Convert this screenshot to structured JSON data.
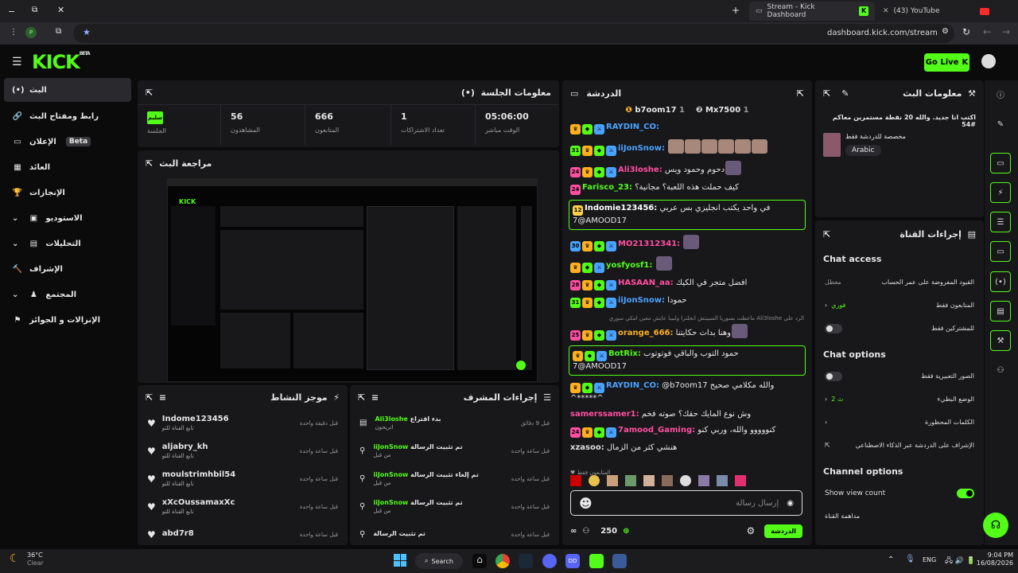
{
  "browser": {
    "tab1": "Stream - Kick Dashboard",
    "tab2": "(43) YouTube",
    "url": "dashboard.kick.com/stream",
    "profile": "P"
  },
  "header": {
    "logo": "KICK",
    "logo_sup": "BETA",
    "go_live": "Go Live"
  },
  "nav": [
    {
      "label": "البث",
      "icon": "(•)"
    },
    {
      "label": "رابط ومفتاح البث",
      "icon": "🔗"
    },
    {
      "label": "الإعلان",
      "icon": "▭",
      "beta": "Beta"
    },
    {
      "label": "العائد",
      "icon": "▦"
    },
    {
      "label": "الإنجازات",
      "icon": "🏆"
    },
    {
      "label": "الاستوديو",
      "icon": "▣"
    },
    {
      "label": "التحليلات",
      "icon": "▤"
    },
    {
      "label": "الإشراف",
      "icon": "🔨"
    },
    {
      "label": "المجتمع",
      "icon": "♟"
    },
    {
      "label": "الإنزالات و الجوائز",
      "icon": "⚑"
    }
  ],
  "session": {
    "title": "معلومات الجلسة",
    "badge": "سليم",
    "badge_label": "الجلسة",
    "stats": [
      {
        "value": "56",
        "label": "المشاهدون"
      },
      {
        "value": "666",
        "label": "المتابعون"
      },
      {
        "value": "1",
        "label": "تعداد الاشتراكات"
      },
      {
        "value": "05:06:00",
        "label": "الوقت مباشر"
      }
    ]
  },
  "preview": {
    "title": "مراجعة البث"
  },
  "activity": {
    "title": "موجز النشاط",
    "items": [
      {
        "name": "Indome123456",
        "sub": "تابع القناة للتو",
        "time": "قبل دقيقة واحدة"
      },
      {
        "name": "aljabry_kh",
        "sub": "تابع القناة للتو",
        "time": "قبل ساعة واحدة"
      },
      {
        "name": "moulstrimhbil54",
        "sub": "تابع القناة للتو",
        "time": "قبل ساعة واحدة"
      },
      {
        "name": "xXcOussamaxXc",
        "sub": "تابع القناة للتو",
        "time": "قبل ساعة واحدة"
      },
      {
        "name": "abd7r8",
        "sub": "",
        "time": "قبل ساعة واحدة"
      }
    ]
  },
  "mod": {
    "title": "إجراءات المشرف",
    "items": [
      {
        "action": "بدء اقتراع",
        "user": "Ali3loshe",
        "sub": "اتريحون",
        "time": "قبل 9 دقائق"
      },
      {
        "action": "تم تثبيت الرسالة",
        "user": "iiJonSnow",
        "sub": "من قبل",
        "time": "قبل ساعة واحدة"
      },
      {
        "action": "تم إلغاء تثبيت الرسالة",
        "user": "iiJonSnow",
        "sub": "من قبل",
        "time": "قبل ساعة واحدة"
      },
      {
        "action": "تم تثبيت الرسالة",
        "user": "iiJonSnow",
        "sub": "من قبل",
        "time": "قبل ساعة واحدة"
      },
      {
        "action": "تم تثبيت الرسالة",
        "user": "",
        "sub": "",
        "time": "قبل ساعة واحدة"
      }
    ]
  },
  "chat": {
    "title": "الدردشة",
    "top1": "b7oom17",
    "top1_n": "1",
    "top2": "Mx7500",
    "top2_n": "1",
    "messages": [
      {
        "user": "RAYDIN_CO",
        "text": "",
        "color": "#4aa3ff",
        "badge": ""
      },
      {
        "user": "iiJonSnow",
        "text": "",
        "color": "#4aa3ff",
        "badge": "31"
      },
      {
        "user": "Ali3loshe",
        "text": "دحوم وحمود ويس",
        "color": "#ff4fa0",
        "badge": "24"
      },
      {
        "user": "Farisco_23",
        "text": "كيف حملت هذه اللعبة؟ مجانية؟",
        "color": "#53fc18",
        "badge": "24"
      },
      {
        "user": "Indomie123456",
        "text": "في واحد يكتب انجليزي بس عربي",
        "color": "#fff",
        "badge": "12",
        "extra": "7@AMOOD17"
      },
      {
        "user": "MO21312341",
        "text": "",
        "color": "#ff4fa0",
        "badge": "30"
      },
      {
        "user": "yosfyosf1",
        "text": "",
        "color": "#53fc18",
        "badge": ""
      },
      {
        "user": "HASAAN_aa",
        "text": "افضل متجر في الكيك",
        "color": "#ff4fa0",
        "badge": "28"
      },
      {
        "user": "iiJonSnow",
        "text": "حمودا",
        "color": "#4aa3ff",
        "badge": "31"
      },
      {
        "user": "orange_666",
        "text": "وهنا بدات حكايتنا",
        "color": "#ffb020",
        "badge": "25",
        "reply": "ماعطت بسوريا السبيتش انجلترا ولبيبا عايش معين امكي سوري Ali3loshe الرد على"
      },
      {
        "user": "BotRix",
        "text": "حمود التوب والباقي فوتوتوب",
        "color": "#53fc18",
        "badge": "",
        "extra": "7@AMOOD17"
      },
      {
        "user": "RAYDIN_CO",
        "text": "@b7oom17 والله مكلامي صحيح",
        "color": "#4aa3ff",
        "badge": "",
        "extra": "^*****^"
      },
      {
        "user": "samerssamer1",
        "text": "وش نوع المايك حقك؟ صوته فخم",
        "color": "#ff4fa0",
        "badge": ""
      },
      {
        "user": "7amood_Gaming",
        "text": "كنووووو والله، وربي كنو",
        "color": "#ff4fa0",
        "badge": "24"
      },
      {
        "user": "xzasoo",
        "text": "هنشي كثر من الزمال",
        "color": "#ddd",
        "badge": ""
      }
    ],
    "followers_only": "المتابعون فقط",
    "placeholder": "إرسال رسالة",
    "points": "250",
    "send": "الدردشة"
  },
  "stream_info": {
    "title": "معلومات البث",
    "text": "اكتب انا جديد. والله 20 نقطة مستمرين معاكم #54",
    "sub": "مخصصة للدردشة فقط",
    "tag": "Arabic"
  },
  "channel": {
    "title": "إجراءات القناة",
    "chat_access": "Chat access",
    "access_rows": [
      {
        "label": "القيود المفروضة على عمر الحساب",
        "value": "معطل"
      },
      {
        "label": "المتابعون فقط",
        "value": "فوري"
      },
      {
        "label": "للمشتركين فقط",
        "value": ""
      }
    ],
    "chat_options": "Chat options",
    "option_rows": [
      {
        "label": "الصور التعبيرية فقط",
        "value": ""
      },
      {
        "label": "الوضع البطيء",
        "value": "2 ث"
      },
      {
        "label": "الكلمات المحظورة",
        "value": ""
      },
      {
        "label": "الإشراف على الدردشة عبر الذكاء الاصطناعي",
        "value": ""
      }
    ],
    "channel_options": "Channel options",
    "show_view_count": "Show view count",
    "channel_row": "مداهمة القناة"
  },
  "taskbar": {
    "temp": "36°C",
    "weather": "Clear",
    "search": "Search",
    "lang": "ENG",
    "time": "9:04 PM",
    "date": "16/08/2026"
  }
}
